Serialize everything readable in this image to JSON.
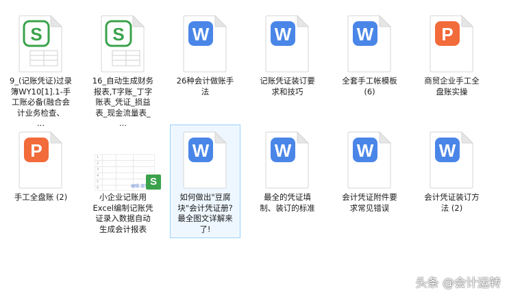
{
  "files": [
    {
      "type": "sheet",
      "label": "9_(记账凭证)过录\n簿WY10[1].1-手\n工账必备(融合会\n计业务检查、\n..."
    },
    {
      "type": "sheet",
      "label": "16_自动生成财务\n报表,T字账_丁字\n账表_凭证_损益\n表_现金流量表_\n..."
    },
    {
      "type": "word",
      "label": "26种会计做账手\n法"
    },
    {
      "type": "word",
      "label": "记账凭证装订要\n求和技巧"
    },
    {
      "type": "word",
      "label": "全套手工帐模板\n(6)"
    },
    {
      "type": "ppt",
      "label": "商贸企业手工全\n盘账实操"
    },
    {
      "type": "ppt",
      "label": "手工全盘账 (2)"
    },
    {
      "type": "xls-thumb",
      "label": "小企业记账用\nExcel编制记账凭\n证录入数据自动\n生成会计报表"
    },
    {
      "type": "word",
      "label": "如何做出\"豆腐\n块\"会计凭证册?\n最全图文详解来\n了!",
      "selected": true
    },
    {
      "type": "word",
      "label": "最全的凭证填\n制、装订的标准"
    },
    {
      "type": "word",
      "label": "会计凭证附件要\n求常见错误"
    },
    {
      "type": "word",
      "label": "会计凭证装订方\n法 (2)"
    }
  ],
  "xls_badge": "S",
  "xls_tag": "编辑-填写",
  "icon_letters": {
    "sheet": "S",
    "word": "W",
    "ppt": "P"
  },
  "colors": {
    "sheet": "#3aa24b",
    "word": "#4a86e8",
    "ppt": "#f26b3a"
  },
  "watermark": "头条 @会计运转"
}
